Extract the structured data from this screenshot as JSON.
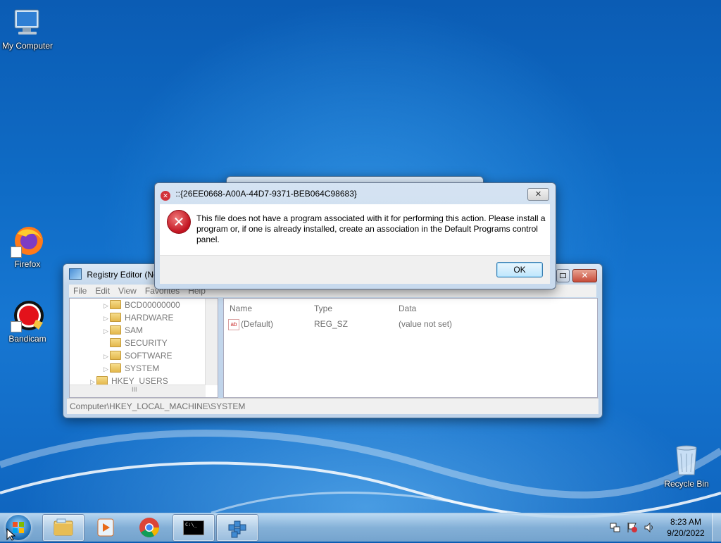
{
  "desktop": {
    "icons": [
      {
        "label": "My Computer"
      },
      {
        "label": "Firefox"
      },
      {
        "label": "Bandicam"
      },
      {
        "label": "Recycle Bin"
      }
    ]
  },
  "registry_editor": {
    "title": "Registry Editor (No",
    "menu": [
      "File",
      "Edit",
      "View",
      "Favorites",
      "Help"
    ],
    "tree_items": [
      "BCD00000000",
      "HARDWARE",
      "SAM",
      "SECURITY",
      "SOFTWARE",
      "SYSTEM",
      "HKEY_USERS"
    ],
    "columns": [
      "Name",
      "Type",
      "Data"
    ],
    "rows": [
      {
        "name": "(Default)",
        "type": "REG_SZ",
        "data": "(value not set)"
      }
    ],
    "scroll_label": "III",
    "status_path": "Computer\\HKEY_LOCAL_MACHINE\\SYSTEM"
  },
  "error_dialog": {
    "title": "::{26EE0668-A00A-44D7-9371-BEB064C98683}",
    "message": "This file does not have a program associated with it for performing this action. Please install a program or, if one is already installed, create an association in the Default Programs control panel.",
    "ok_label": "OK",
    "close_symbol": "✕"
  },
  "taskbar": {
    "start_icon": "windows-orb-icon",
    "buttons": [
      {
        "icon": "file-explorer-icon",
        "active": true
      },
      {
        "icon": "media-player-icon",
        "active": false
      },
      {
        "icon": "chrome-icon",
        "active": false
      },
      {
        "icon": "command-prompt-icon",
        "active": true
      },
      {
        "icon": "registry-editor-icon",
        "active": true
      }
    ],
    "cmd_glyph": "C:\\_",
    "tray_icons": [
      "network-icon",
      "action-center-flag-icon",
      "volume-icon"
    ],
    "clock_time": "8:23 AM",
    "clock_date": "9/20/2022"
  },
  "colors": {
    "error_red": "#d2323a",
    "desktop_blue": "#0f6cc6",
    "close_red": "#c74c3a"
  }
}
